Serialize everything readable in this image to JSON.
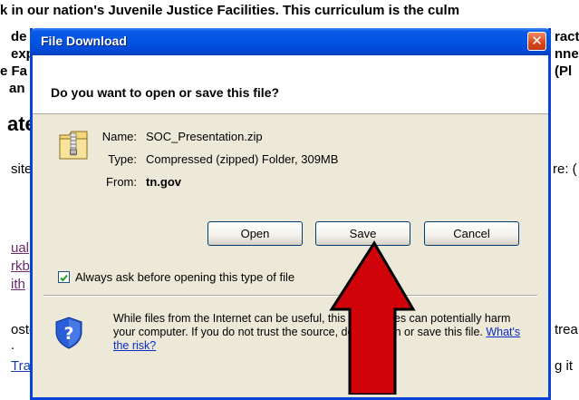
{
  "background": {
    "line1": "k in our nation's Juvenile Justice Facilities. This curriculum is the culm",
    "l2_left": "de",
    "l2_right": "ract",
    "l3_left": "exp",
    "l3_right": "nne",
    "l4_left": "e Fa",
    "l4_right": "(Pl",
    "l5_left": "an",
    "heading": "ate",
    "l6_left": "site",
    "l6_right": "re: (",
    "link1": "ual",
    "link2": "rkb",
    "link3": "ith",
    "l7_left": "oste",
    "l7_right": "trea",
    "l8_left": ".",
    "link4": "Tra",
    "l8_right": "g it"
  },
  "dialog": {
    "title": "File Download",
    "close_glyph": "✕",
    "question": "Do you want to open or save this file?",
    "fields": {
      "name_label": "Name:",
      "name_value": "SOC_Presentation.zip",
      "type_label": "Type:",
      "type_value": "Compressed (zipped) Folder, 309MB",
      "from_label": "From:",
      "from_value": "tn.gov"
    },
    "buttons": {
      "open": "Open",
      "save": "Save",
      "cancel": "Cancel"
    },
    "checkbox": {
      "label": "Always ask before opening this type of file",
      "checked": true
    },
    "warning": {
      "text": "While files from the Internet can be useful, this type of files can potentially harm your computer. If you do not trust the source, do not open or save this file.",
      "link": "What's the risk?"
    },
    "icons": {
      "file": "zip-folder-icon",
      "security": "shield-question-icon",
      "pointer": "red-arrow-icon"
    },
    "colors": {
      "titlebar": "#0054e3",
      "dialog_bg": "#ece9d8",
      "arrow": "#d0020a",
      "close": "#d9451b"
    }
  }
}
